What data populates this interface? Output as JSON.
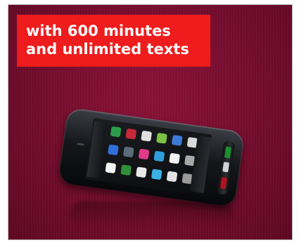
{
  "banner": {
    "headline_line1": "with 600 minutes",
    "headline_line2": "and unlimited texts",
    "headline_bg": "#ee1c1c",
    "background_color": "#730c2d"
  },
  "phone": {
    "app_icon_colors": [
      "#2a9d4b",
      "#c7283a",
      "#e0e0e0",
      "#7cc242",
      "#3d7ad6",
      "#d9d9d9",
      "#2f6fd6",
      "#5a6c7a",
      "#e33a8a",
      "#2f9fd9",
      "#f2f2f2",
      "#a8a8a8",
      "#f3f3f3",
      "#2f8f3a",
      "#e8e8e8",
      "#3bb1e6",
      "#e2e2e2",
      "#9a9a9a"
    ]
  }
}
